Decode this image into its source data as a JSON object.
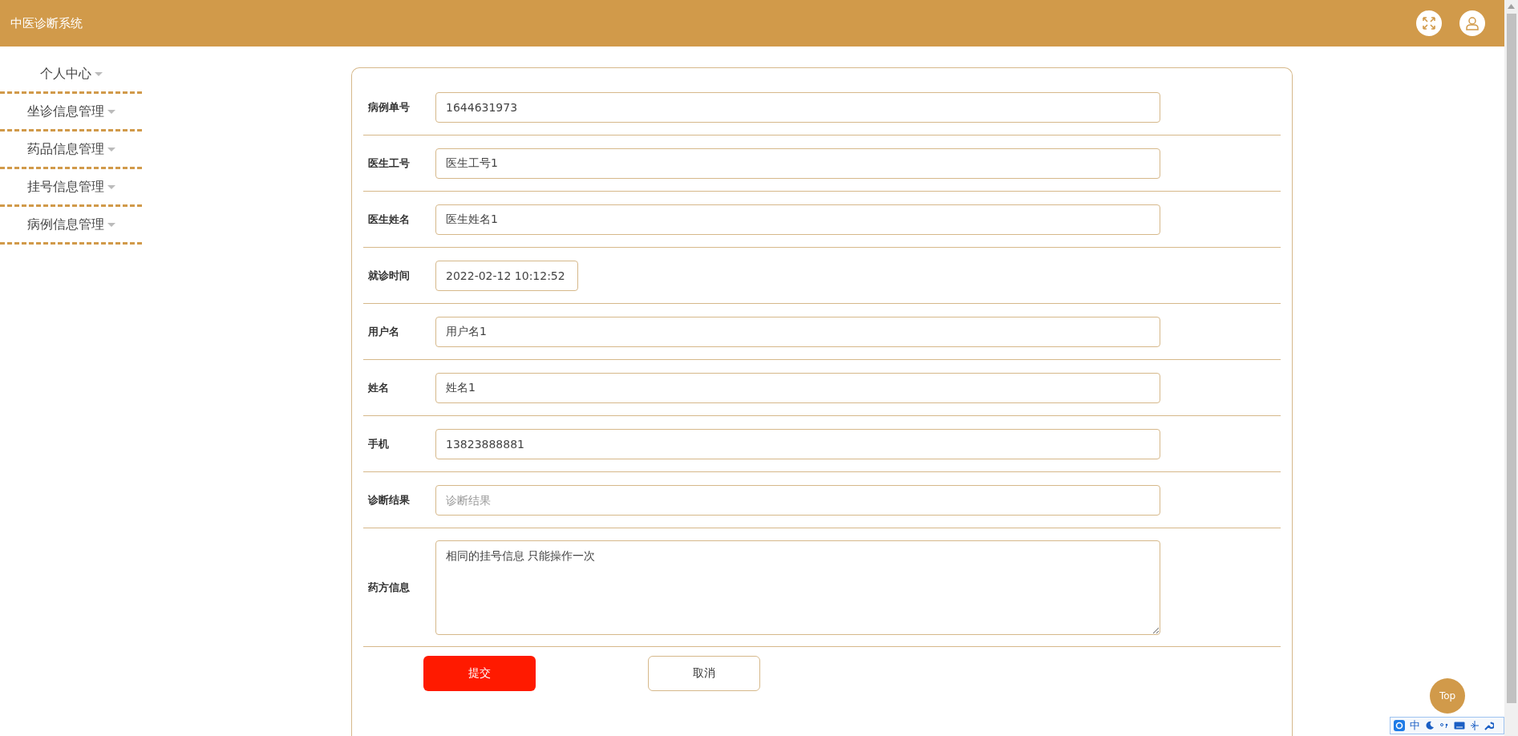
{
  "header": {
    "title": "中医诊断系统"
  },
  "sidebar": {
    "items": [
      {
        "label": "个人中心"
      },
      {
        "label": "坐诊信息管理"
      },
      {
        "label": "药品信息管理"
      },
      {
        "label": "挂号信息管理"
      },
      {
        "label": "病例信息管理"
      }
    ]
  },
  "form": {
    "fields": [
      {
        "label": "病例单号",
        "kind": "input",
        "value": "1644631973"
      },
      {
        "label": "医生工号",
        "kind": "input",
        "value": "医生工号1"
      },
      {
        "label": "医生姓名",
        "kind": "input",
        "value": "医生姓名1"
      },
      {
        "label": "就诊时间",
        "kind": "date",
        "value": "2022-02-12 10:12:52"
      },
      {
        "label": "用户名",
        "kind": "input",
        "value": "用户名1"
      },
      {
        "label": "姓名",
        "kind": "input",
        "value": "姓名1"
      },
      {
        "label": "手机",
        "kind": "input",
        "value": "13823888881"
      },
      {
        "label": "诊断结果",
        "kind": "input",
        "placeholder": "诊断结果"
      },
      {
        "label": "药方信息",
        "kind": "textarea",
        "value": "相同的挂号信息 只能操作一次"
      }
    ],
    "buttons": [
      {
        "label": "提交",
        "kind": "primary"
      },
      {
        "label": "取消",
        "kind": "secondary"
      }
    ]
  },
  "back_to_top": "Top",
  "ime_toolbar": {
    "mode": "中"
  }
}
